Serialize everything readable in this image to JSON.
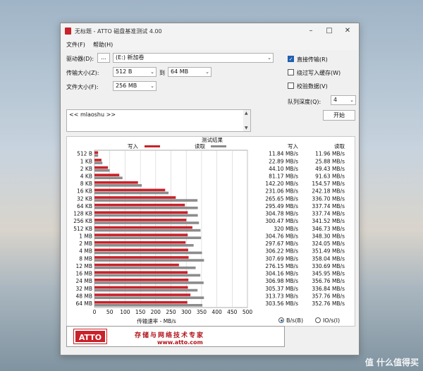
{
  "window": {
    "title": "无标题 - ATTO 磁盘基准测试 4.00"
  },
  "menu": {
    "file": "文件(F)",
    "help": "帮助(H)"
  },
  "form": {
    "drive_label": "驱动器(D):",
    "browse_label": "...",
    "drive_value": "(E:) 新加卷",
    "transfer_label": "传输大小(Z):",
    "transfer_from": "512 B",
    "transfer_to_label": "到",
    "transfer_to": "64 MB",
    "file_size_label": "文件大小(F):",
    "file_size": "256 MB",
    "direct_io_label": "直接传输(R)",
    "direct_io_checked": true,
    "bypass_cache_label": "绕过写入缓存(W)",
    "bypass_cache_checked": false,
    "verify_label": "校验数据(V)",
    "verify_checked": false,
    "queue_depth_label": "队列深度(Q):",
    "queue_depth": "4",
    "start_label": "开始",
    "notes_text": "<< mlaoshu >>"
  },
  "results": {
    "heading": "测试结果",
    "col_write": "写入",
    "col_read": "读取",
    "radio_bs": "B/s(B)",
    "radio_ios": "IO/s(I)",
    "radio_selected": "bs"
  },
  "chart_data": {
    "type": "bar",
    "title": "测试结果",
    "xlabel": "传输速率 - MB/s",
    "xlim": [
      0,
      500
    ],
    "xticks": [
      "0",
      "50",
      "100",
      "150",
      "200",
      "250",
      "300",
      "350",
      "400",
      "450",
      "500"
    ],
    "legend": [
      "写入",
      "读取"
    ],
    "grid": true,
    "colors": {
      "write": "#c8222a",
      "read": "#8c8c8c"
    },
    "categories": [
      "512 B",
      "1 KB",
      "2 KB",
      "4 KB",
      "8 KB",
      "16 KB",
      "32 KB",
      "64 KB",
      "128 KB",
      "256 KB",
      "512 KB",
      "1 MB",
      "2 MB",
      "4 MB",
      "8 MB",
      "12 MB",
      "16 MB",
      "24 MB",
      "32 MB",
      "48 MB",
      "64 MB"
    ],
    "series": [
      {
        "name": "写入",
        "values": [
          11.84,
          22.89,
          44.1,
          81.17,
          142.2,
          231.06,
          265.65,
          295.49,
          304.78,
          300.47,
          320,
          304.76,
          297.67,
          306.22,
          307.69,
          276.15,
          304.16,
          306.98,
          305.37,
          313.73,
          303.56
        ]
      },
      {
        "name": "读取",
        "values": [
          11.96,
          25.88,
          49.43,
          91.63,
          154.57,
          242.18,
          336.7,
          337.74,
          337.74,
          341.52,
          346.73,
          348.3,
          324.05,
          351.49,
          358.04,
          330.69,
          345.95,
          356.76,
          336.84,
          357.76,
          352.76
        ]
      }
    ],
    "write_labels": [
      "11.84 MB/s",
      "22.89 MB/s",
      "44.10 MB/s",
      "81.17 MB/s",
      "142.20 MB/s",
      "231.06 MB/s",
      "265.65 MB/s",
      "295.49 MB/s",
      "304.78 MB/s",
      "300.47 MB/s",
      "320 MB/s",
      "304.76 MB/s",
      "297.67 MB/s",
      "306.22 MB/s",
      "307.69 MB/s",
      "276.15 MB/s",
      "304.16 MB/s",
      "306.98 MB/s",
      "305.37 MB/s",
      "313.73 MB/s",
      "303.56 MB/s"
    ],
    "read_labels": [
      "11.96 MB/s",
      "25.88 MB/s",
      "49.43 MB/s",
      "91.63 MB/s",
      "154.57 MB/s",
      "242.18 MB/s",
      "336.70 MB/s",
      "337.74 MB/s",
      "337.74 MB/s",
      "341.52 MB/s",
      "346.73 MB/s",
      "348.30 MB/s",
      "324.05 MB/s",
      "351.49 MB/s",
      "358.04 MB/s",
      "330.69 MB/s",
      "345.95 MB/s",
      "356.76 MB/s",
      "336.84 MB/s",
      "357.76 MB/s",
      "352.76 MB/s"
    ]
  },
  "ad": {
    "logo": "ATTO",
    "slogan": "存储与网络技术专家",
    "url": "www.atto.com"
  },
  "watermark": "值 什么值得买"
}
